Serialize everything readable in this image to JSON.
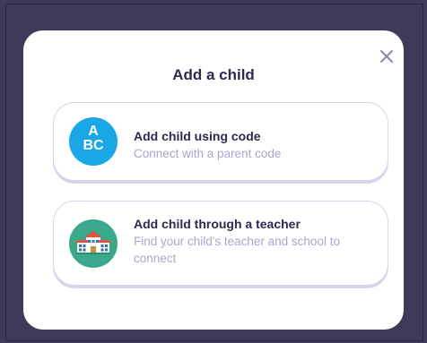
{
  "modal": {
    "title": "Add a child",
    "close_icon": "close-icon"
  },
  "options": [
    {
      "title": "Add child using code",
      "subtitle": "Connect with a parent code",
      "icon": "abc-icon",
      "icon_text_top": "A",
      "icon_text_bottom": "BC",
      "icon_color": "#1aa7e8"
    },
    {
      "title": "Add child through a teacher",
      "subtitle": "Find your child's teacher and school to connect",
      "icon": "school-icon",
      "icon_color": "#3aa88a"
    }
  ],
  "colors": {
    "backdrop": "#3f3a5a",
    "title_text": "#2c2a50",
    "subtitle_text": "#a8a7cc",
    "card_border": "#d6d5ea"
  }
}
